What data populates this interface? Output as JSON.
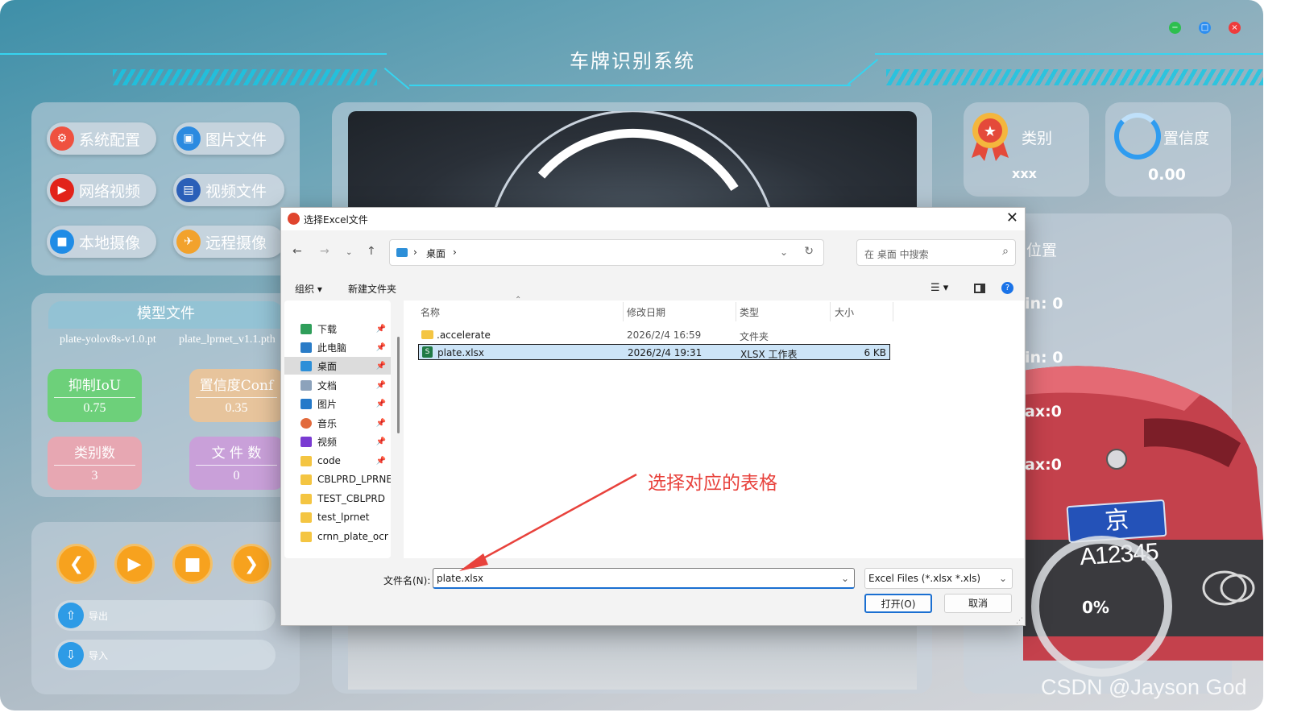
{
  "app": {
    "title": "车牌识别系统"
  },
  "window_controls": {
    "minimize": "−",
    "maximize": "□",
    "close": "×"
  },
  "left_menu": {
    "system_config": "系统配置",
    "image_file": "图片文件",
    "network_video": "网络视频",
    "video_file": "视频文件",
    "local_camera": "本地摄像",
    "remote_camera": "远程摄像"
  },
  "model": {
    "title": "模型文件",
    "detect_model": "plate-yolov8s-v1.0.pt",
    "recog_model": "plate_lprnet_v1.1.pth"
  },
  "stats": {
    "iou_label": "抑制IoU",
    "iou_value": "0.75",
    "conf_label": "置信度Conf",
    "conf_value": "0.35",
    "classes_label": "类别数",
    "classes_value": "3",
    "files_label": "文 件 数",
    "files_value": "0"
  },
  "io": {
    "export_label": "导出",
    "import_label": "导入"
  },
  "result": {
    "class_label": "类别",
    "class_value": "xxx",
    "confidence_label": "置信度",
    "confidence_value": "0.00",
    "position_label": "位置",
    "xmin": "in: 0",
    "ymin": "in: 0",
    "xmax": "ax:0",
    "ymax": "ax:0"
  },
  "car": {
    "plate_text": "京A12345"
  },
  "progress": {
    "label": "0%",
    "percent": 0
  },
  "watermark": "CSDN @Jayson God",
  "dialog": {
    "title": "选择Excel文件",
    "breadcrumb": "桌面",
    "search_placeholder": "在 桌面 中搜索",
    "organize": "组织",
    "new_folder": "新建文件夹",
    "sidebar": [
      "下载",
      "此电脑",
      "桌面",
      "文档",
      "图片",
      "音乐",
      "视频",
      "code",
      "CBLPRD_LPRNE",
      "TEST_CBLPRD",
      "test_lprnet",
      "crnn_plate_ocr"
    ],
    "columns": {
      "name": "名称",
      "date": "修改日期",
      "type": "类型",
      "size": "大小"
    },
    "files": [
      {
        "name": ".accelerate",
        "date": "2026/2/4 16:59",
        "type": "文件夹",
        "size": ""
      },
      {
        "name": "plate.xlsx",
        "date": "2026/2/4 19:31",
        "type": "XLSX 工作表",
        "size": "6 KB"
      }
    ],
    "filename_label": "文件名(N):",
    "filename_value": "plate.xlsx",
    "filetype_value": "Excel Files (*.xlsx *.xls)",
    "open_button": "打开(O)",
    "cancel_button": "取消"
  },
  "annotation": "选择对应的表格",
  "colors": {
    "accent_cyan": "#36d4f0",
    "orange": "#f7a21e",
    "annotation_red": "#e8423c",
    "selection_blue": "#cce4f7"
  }
}
